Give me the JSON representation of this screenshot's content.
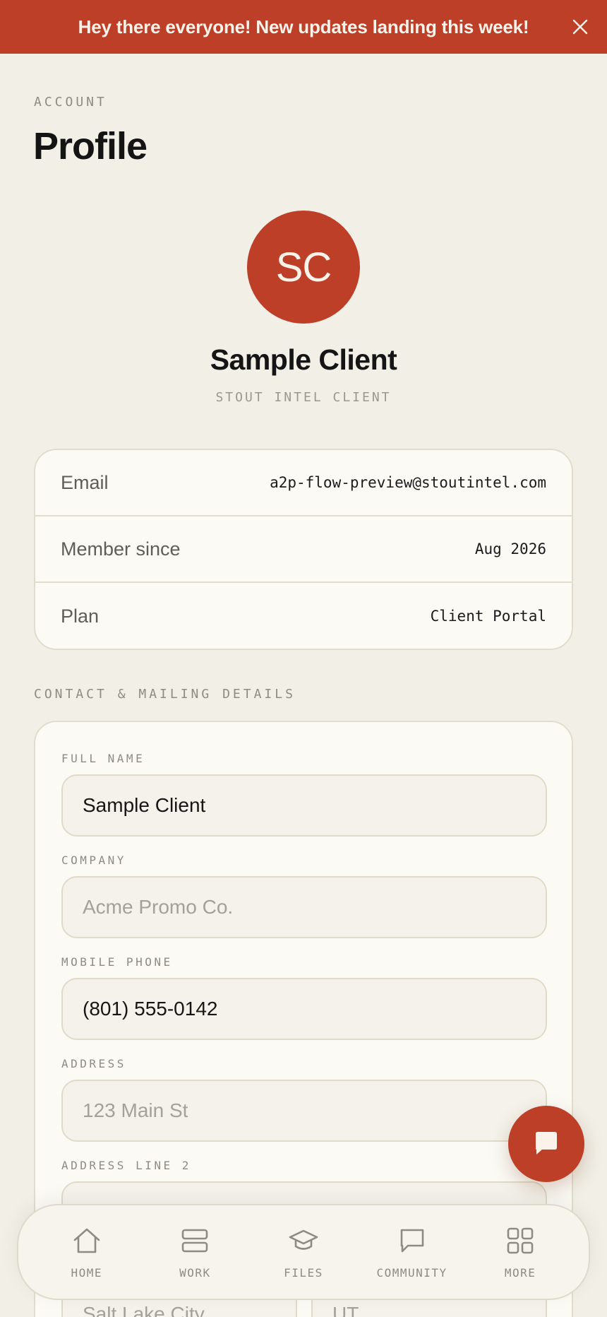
{
  "banner": {
    "text": "Hey there everyone! New updates landing this week!",
    "close_icon": "close-icon"
  },
  "header": {
    "eyebrow": "ACCOUNT",
    "title": "Profile"
  },
  "profile": {
    "initials": "SC",
    "name": "Sample Client",
    "role": "STOUT INTEL CLIENT"
  },
  "account_info": [
    {
      "label": "Email",
      "value": "a2p-flow-preview@stoutintel.com"
    },
    {
      "label": "Member since",
      "value": "Aug 2026"
    },
    {
      "label": "Plan",
      "value": "Client Portal"
    }
  ],
  "contact": {
    "section_title": "CONTACT & MAILING DETAILS",
    "full_name": {
      "label": "FULL NAME",
      "value": "Sample Client",
      "placeholder": ""
    },
    "company": {
      "label": "COMPANY",
      "value": "",
      "placeholder": "Acme Promo Co."
    },
    "mobile_phone": {
      "label": "MOBILE PHONE",
      "value": "(801) 555-0142",
      "placeholder": ""
    },
    "address": {
      "label": "ADDRESS",
      "value": "",
      "placeholder": "123 Main St"
    },
    "address_line_2": {
      "label": "ADDRESS LINE 2",
      "value": "",
      "placeholder": ""
    },
    "city": {
      "value": "",
      "placeholder": "Salt Lake City"
    },
    "state": {
      "value": "",
      "placeholder": "UT"
    }
  },
  "chat_button": {
    "icon": "chat-bubble-icon"
  },
  "tabbar": {
    "items": [
      {
        "label": "HOME",
        "icon": "home-icon"
      },
      {
        "label": "WORK",
        "icon": "work-icon"
      },
      {
        "label": "FILES",
        "icon": "graduation-cap-icon"
      },
      {
        "label": "COMMUNITY",
        "icon": "speech-bubble-icon"
      },
      {
        "label": "MORE",
        "icon": "grid-icon"
      }
    ]
  },
  "colors": {
    "accent": "#bd3f28",
    "background": "#f1efe6",
    "card": "#fbfaf5"
  }
}
